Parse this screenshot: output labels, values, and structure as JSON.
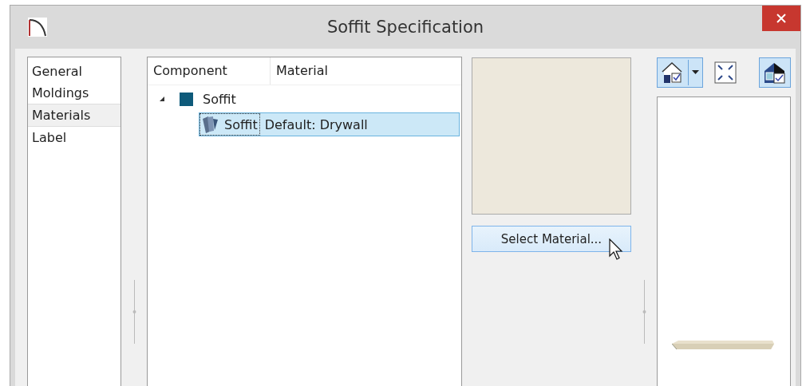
{
  "window": {
    "title": "Soffit Specification"
  },
  "sidebar": {
    "items": [
      {
        "label": "General",
        "selected": false
      },
      {
        "label": "Moldings",
        "selected": false
      },
      {
        "label": "Materials",
        "selected": true
      },
      {
        "label": "Label",
        "selected": false
      }
    ]
  },
  "tree": {
    "columns": [
      "Component",
      "Material"
    ],
    "rows": [
      {
        "component": "Soffit",
        "expanded": true,
        "selected": false,
        "children": [
          {
            "component": "Soffit",
            "material": "Default: Drywall",
            "selected": true
          }
        ]
      }
    ]
  },
  "select_button": {
    "label": "Select Material..."
  },
  "toolbar": [
    {
      "kind": "view-dropdown",
      "on": true
    },
    {
      "kind": "fit",
      "on": false
    },
    {
      "kind": "display",
      "on": true
    }
  ]
}
